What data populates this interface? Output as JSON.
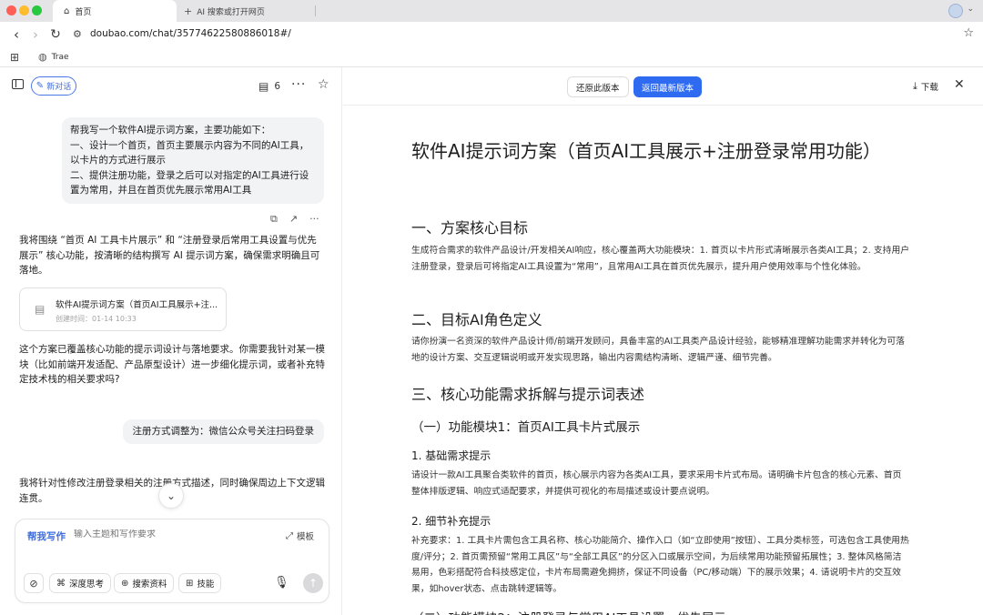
{
  "browser": {
    "active_tab": "首页",
    "new_tab": "AI 搜索或打开网页",
    "url": "doubao.com/chat/35774622580886018#/",
    "bookmark": "Trae"
  },
  "chat": {
    "new_chat_label": "新对话",
    "doc_count": "6",
    "user_message_1": [
      "帮我写一个软件AI提示词方案，主要功能如下：",
      "一、设计一个首页，首页主要展示内容为不同的AI工具，以卡片的方式进行展示",
      "二、提供注册功能，登录之后可以对指定的AI工具进行设置为常用，并且在首页优先展示常用AI工具"
    ],
    "ai_reply_1": "我将围绕 “首页 AI 工具卡片展示” 和 “注册登录后常用工具设置与优先展示” 核心功能，按清晰的结构撰写 AI 提示词方案，确保需求明确且可落地。",
    "doc_card": {
      "title": "软件AI提示词方案（首页AI工具展示+注...",
      "time": "创建时间：01-14 10:33"
    },
    "ai_reply_2": "这个方案已覆盖核心功能的提示词设计与落地要求。你需要我针对某一模块（比如前端开发适配、产品原型设计）进一步细化提示词，或者补充特定技术栈的相关要求吗?",
    "user_message_2": "注册方式调整为：微信公众号关注扫码登录",
    "ai_reply_3": "我将针对性修改注册登录相关的注册方式描述，同时确保周边上下文逻辑连贯。",
    "composer": {
      "mode": "帮我写作",
      "placeholder": "输入主题和写作要求",
      "template": "模板",
      "chips": [
        "深度思考",
        "搜索资料",
        "技能"
      ]
    }
  },
  "document": {
    "toolbar": {
      "restore": "还原此版本",
      "latest": "返回最新版本",
      "download": "下载"
    },
    "title": "软件AI提示词方案（首页AI工具展示+注册登录常用功能）",
    "sections": {
      "s1_heading": "一、方案核心目标",
      "s1_body": "生成符合需求的软件产品设计/开发相关AI响应，核心覆盖两大功能模块：1. 首页以卡片形式清晰展示各类AI工具；2. 支持用户注册登录，登录后可将指定AI工具设置为“常用”，且常用AI工具在首页优先展示，提升用户使用效率与个性化体验。",
      "s2_heading": "二、目标AI角色定义",
      "s2_body": "请你扮演一名资深的软件产品设计师/前端开发顾问，具备丰富的AI工具类产品设计经验，能够精准理解功能需求并转化为可落地的设计方案、交互逻辑说明或开发实现思路，输出内容需结构清晰、逻辑严谨、细节完善。",
      "s3_heading": "三、核心功能需求拆解与提示词表述",
      "s3_sub1": "（一）功能模块1：首页AI工具卡片式展示",
      "s3_sub1_1": "1. 基础需求提示",
      "s3_sub1_1_body": "请设计一款AI工具聚合类软件的首页，核心展示内容为各类AI工具，要求采用卡片式布局。请明确卡片包含的核心元素、首页整体排版逻辑、响应式适配要求，并提供可视化的布局描述或设计要点说明。",
      "s3_sub1_2": "2. 细节补充提示",
      "s3_sub1_2_body": "补充要求：1. 工具卡片需包含工具名称、核心功能简介、操作入口（如“立即使用”按钮）、工具分类标签，可选包含工具使用热度/评分；2. 首页需预留“常用工具区”与“全部工具区”的分区入口或展示空间，为后续常用功能预留拓展性；3. 整体风格简洁易用，色彩搭配符合科技感定位，卡片布局需避免拥挤，保证不同设备（PC/移动端）下的展示效果；4. 请说明卡片的交互效果，如hover状态、点击跳转逻辑等。",
      "s3_sub2": "（二）功能模块2：注册登录与常用AI工具设置、优先展示"
    }
  }
}
